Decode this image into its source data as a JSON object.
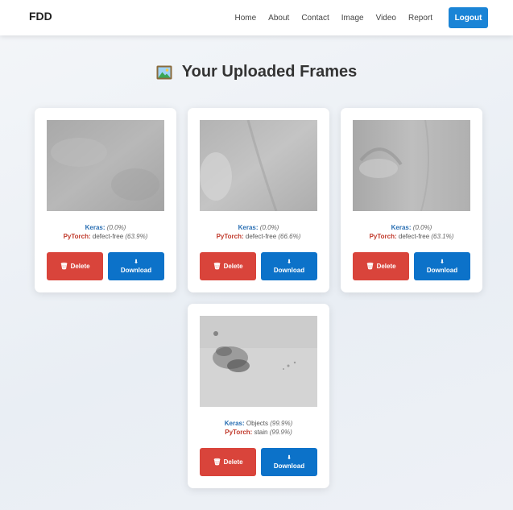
{
  "navbar": {
    "brand": "FDD",
    "links": [
      "Home",
      "About",
      "Contact",
      "Image",
      "Video",
      "Report"
    ],
    "logout_label": "Logout"
  },
  "page": {
    "title": "Your Uploaded Frames"
  },
  "cards": [
    {
      "keras_label": "Keras:",
      "keras_value": "",
      "keras_pct": "(0.0%)",
      "pytorch_label": "PyTorch:",
      "pytorch_value": "defect-free",
      "pytorch_pct": "(63.9%)",
      "delete_label": "Delete",
      "download_label": "Download"
    },
    {
      "keras_label": "Keras:",
      "keras_value": "",
      "keras_pct": "(0.0%)",
      "pytorch_label": "PyTorch:",
      "pytorch_value": "defect-free",
      "pytorch_pct": "(66.6%)",
      "delete_label": "Delete",
      "download_label": "Download"
    },
    {
      "keras_label": "Keras:",
      "keras_value": "",
      "keras_pct": "(0.0%)",
      "pytorch_label": "PyTorch:",
      "pytorch_value": "defect-free",
      "pytorch_pct": "(63.1%)",
      "delete_label": "Delete",
      "download_label": "Download"
    },
    {
      "keras_label": "Keras:",
      "keras_value": "Objects",
      "keras_pct": "(99.9%)",
      "pytorch_label": "PyTorch:",
      "pytorch_value": "stain",
      "pytorch_pct": "(99.9%)",
      "delete_label": "Delete",
      "download_label": "Download"
    }
  ],
  "colors": {
    "logout": "#1a84d6",
    "delete": "#d9443b",
    "download": "#0c72c9",
    "keras": "#2a6fb3",
    "pytorch": "#c0392b"
  },
  "icons": {
    "title": "framed-picture-icon",
    "delete": "trash-icon",
    "download": "download-arrow-icon"
  }
}
